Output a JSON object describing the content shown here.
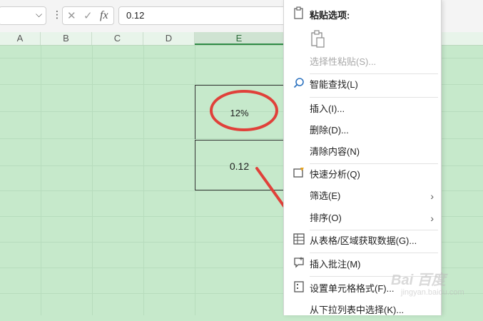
{
  "formula_bar": {
    "name_box_value": "",
    "formula_value": "0.12",
    "icons": [
      "cancel-icon",
      "enter-icon",
      "fx-icon"
    ],
    "fx_label": "fx",
    "cancel_glyph": "✕",
    "enter_glyph": "✓"
  },
  "columns": [
    "A",
    "B",
    "C",
    "D",
    "E"
  ],
  "active_column": "E",
  "cells": {
    "percent_value": "12%",
    "number_value": "0.12"
  },
  "context_menu": {
    "paste_options_title": "粘贴选项:",
    "paste_special": "选择性粘贴(S)...",
    "smart_lookup": "智能查找(L)",
    "insert": "插入(I)...",
    "delete": "删除(D)...",
    "clear_contents": "清除内容(N)",
    "quick_analysis": "快速分析(Q)",
    "filter": "筛选(E)",
    "sort": "排序(O)",
    "get_data": "从表格/区域获取数据(G)...",
    "insert_comment": "插入批注(M)",
    "format_cells": "设置单元格格式(F)...",
    "pick_from_list": "从下拉列表中选择(K)..."
  },
  "colors": {
    "sheet_background": "#c6e9cb",
    "annotation_red": "#e0413a"
  },
  "watermark": {
    "brand": "Bai  百度",
    "url": "jingyan.baidu.com"
  }
}
